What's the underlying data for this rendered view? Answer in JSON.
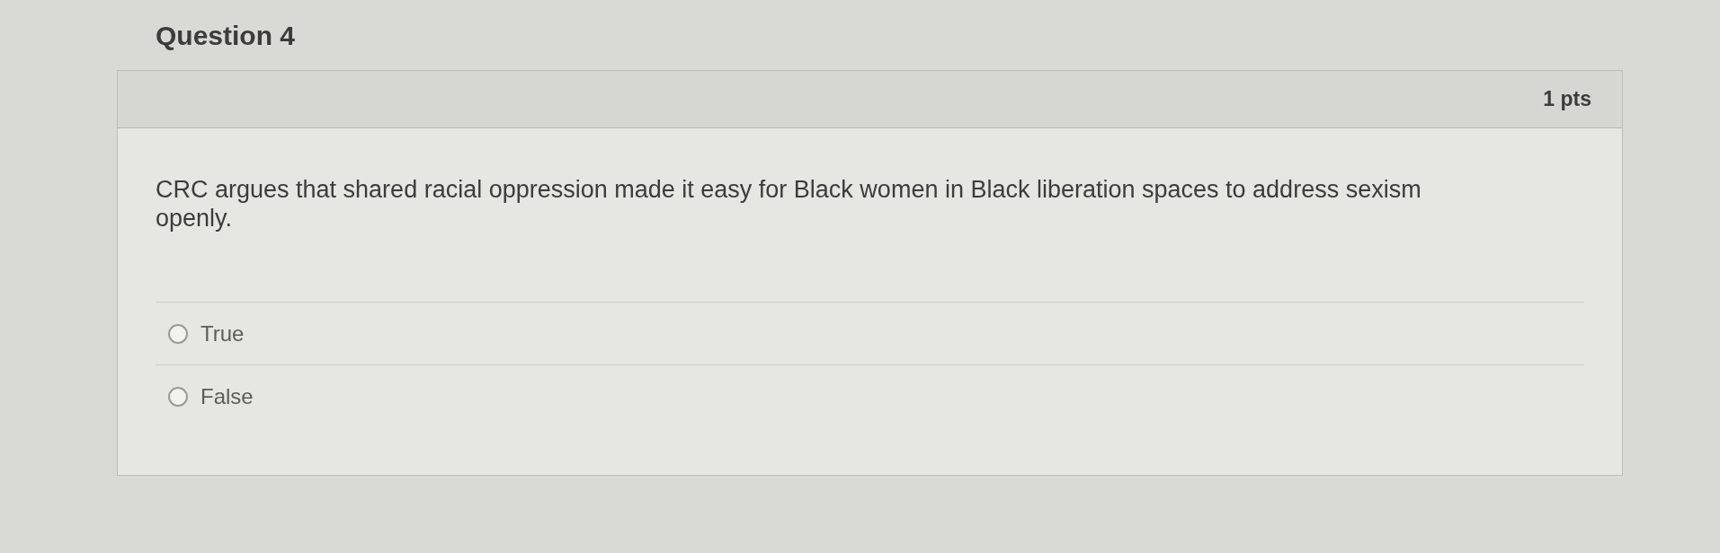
{
  "question": {
    "title": "Question 4",
    "points": "1 pts",
    "text": "CRC argues that shared racial oppression made it easy for Black women in Black liberation spaces to address sexism openly.",
    "options": [
      {
        "label": "True",
        "selected": false
      },
      {
        "label": "False",
        "selected": false
      }
    ]
  }
}
